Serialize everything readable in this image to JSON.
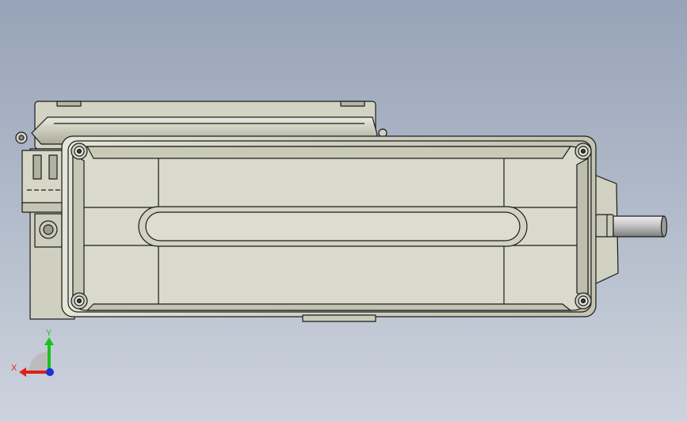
{
  "viewport": {
    "background_top": "#97a3b8",
    "background_bottom": "#cdd3dd"
  },
  "model": {
    "body_color": "#d6d7c8",
    "body_shade": "#b9baa8",
    "edge_color": "#1c1c1c",
    "shaft_color": "#c6c6c6"
  },
  "triad": {
    "x_label": "X",
    "y_label": "Y",
    "x_color": "#e0201a",
    "y_color": "#19c21d",
    "z_color": "#1f2fd8"
  }
}
